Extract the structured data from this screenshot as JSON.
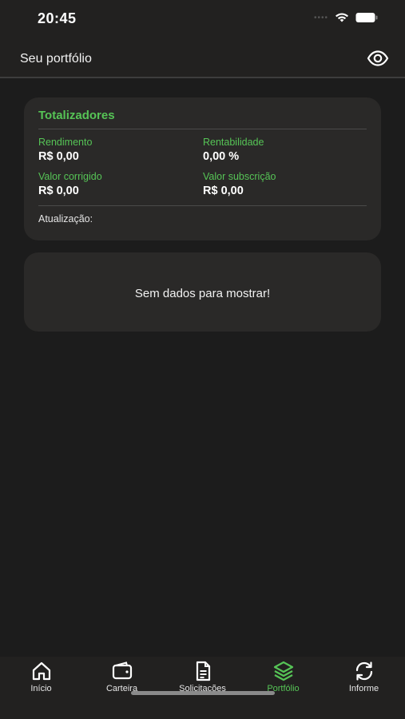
{
  "status_bar": {
    "time": "20:45"
  },
  "header": {
    "title": "Seu portfólio",
    "eye_icon": "eye-icon"
  },
  "totals": {
    "title": "Totalizadores",
    "rendimento_label": "Rendimento",
    "rendimento_value": "R$ 0,00",
    "rentabilidade_label": "Rentabilidade",
    "rentabilidade_value": "0,00 %",
    "valor_corrigido_label": "Valor corrigido",
    "valor_corrigido_value": "R$ 0,00",
    "valor_subscricao_label": "Valor subscrição",
    "valor_subscricao_value": "R$ 0,00",
    "atualizacao_label": "Atualização:"
  },
  "empty_state": {
    "message": "Sem dados para mostrar!"
  },
  "tab_bar": {
    "tabs": [
      {
        "label": "Início",
        "icon": "home-icon",
        "active": false
      },
      {
        "label": "Carteira",
        "icon": "wallet-icon",
        "active": false
      },
      {
        "label": "Solicitações",
        "icon": "document-icon",
        "active": false
      },
      {
        "label": "Portfólio",
        "icon": "layers-icon",
        "active": true
      },
      {
        "label": "Informe",
        "icon": "refresh-icon",
        "active": false
      }
    ]
  },
  "colors": {
    "accent": "#56c456",
    "background": "#1c1c1c",
    "card": "#2a2928"
  }
}
